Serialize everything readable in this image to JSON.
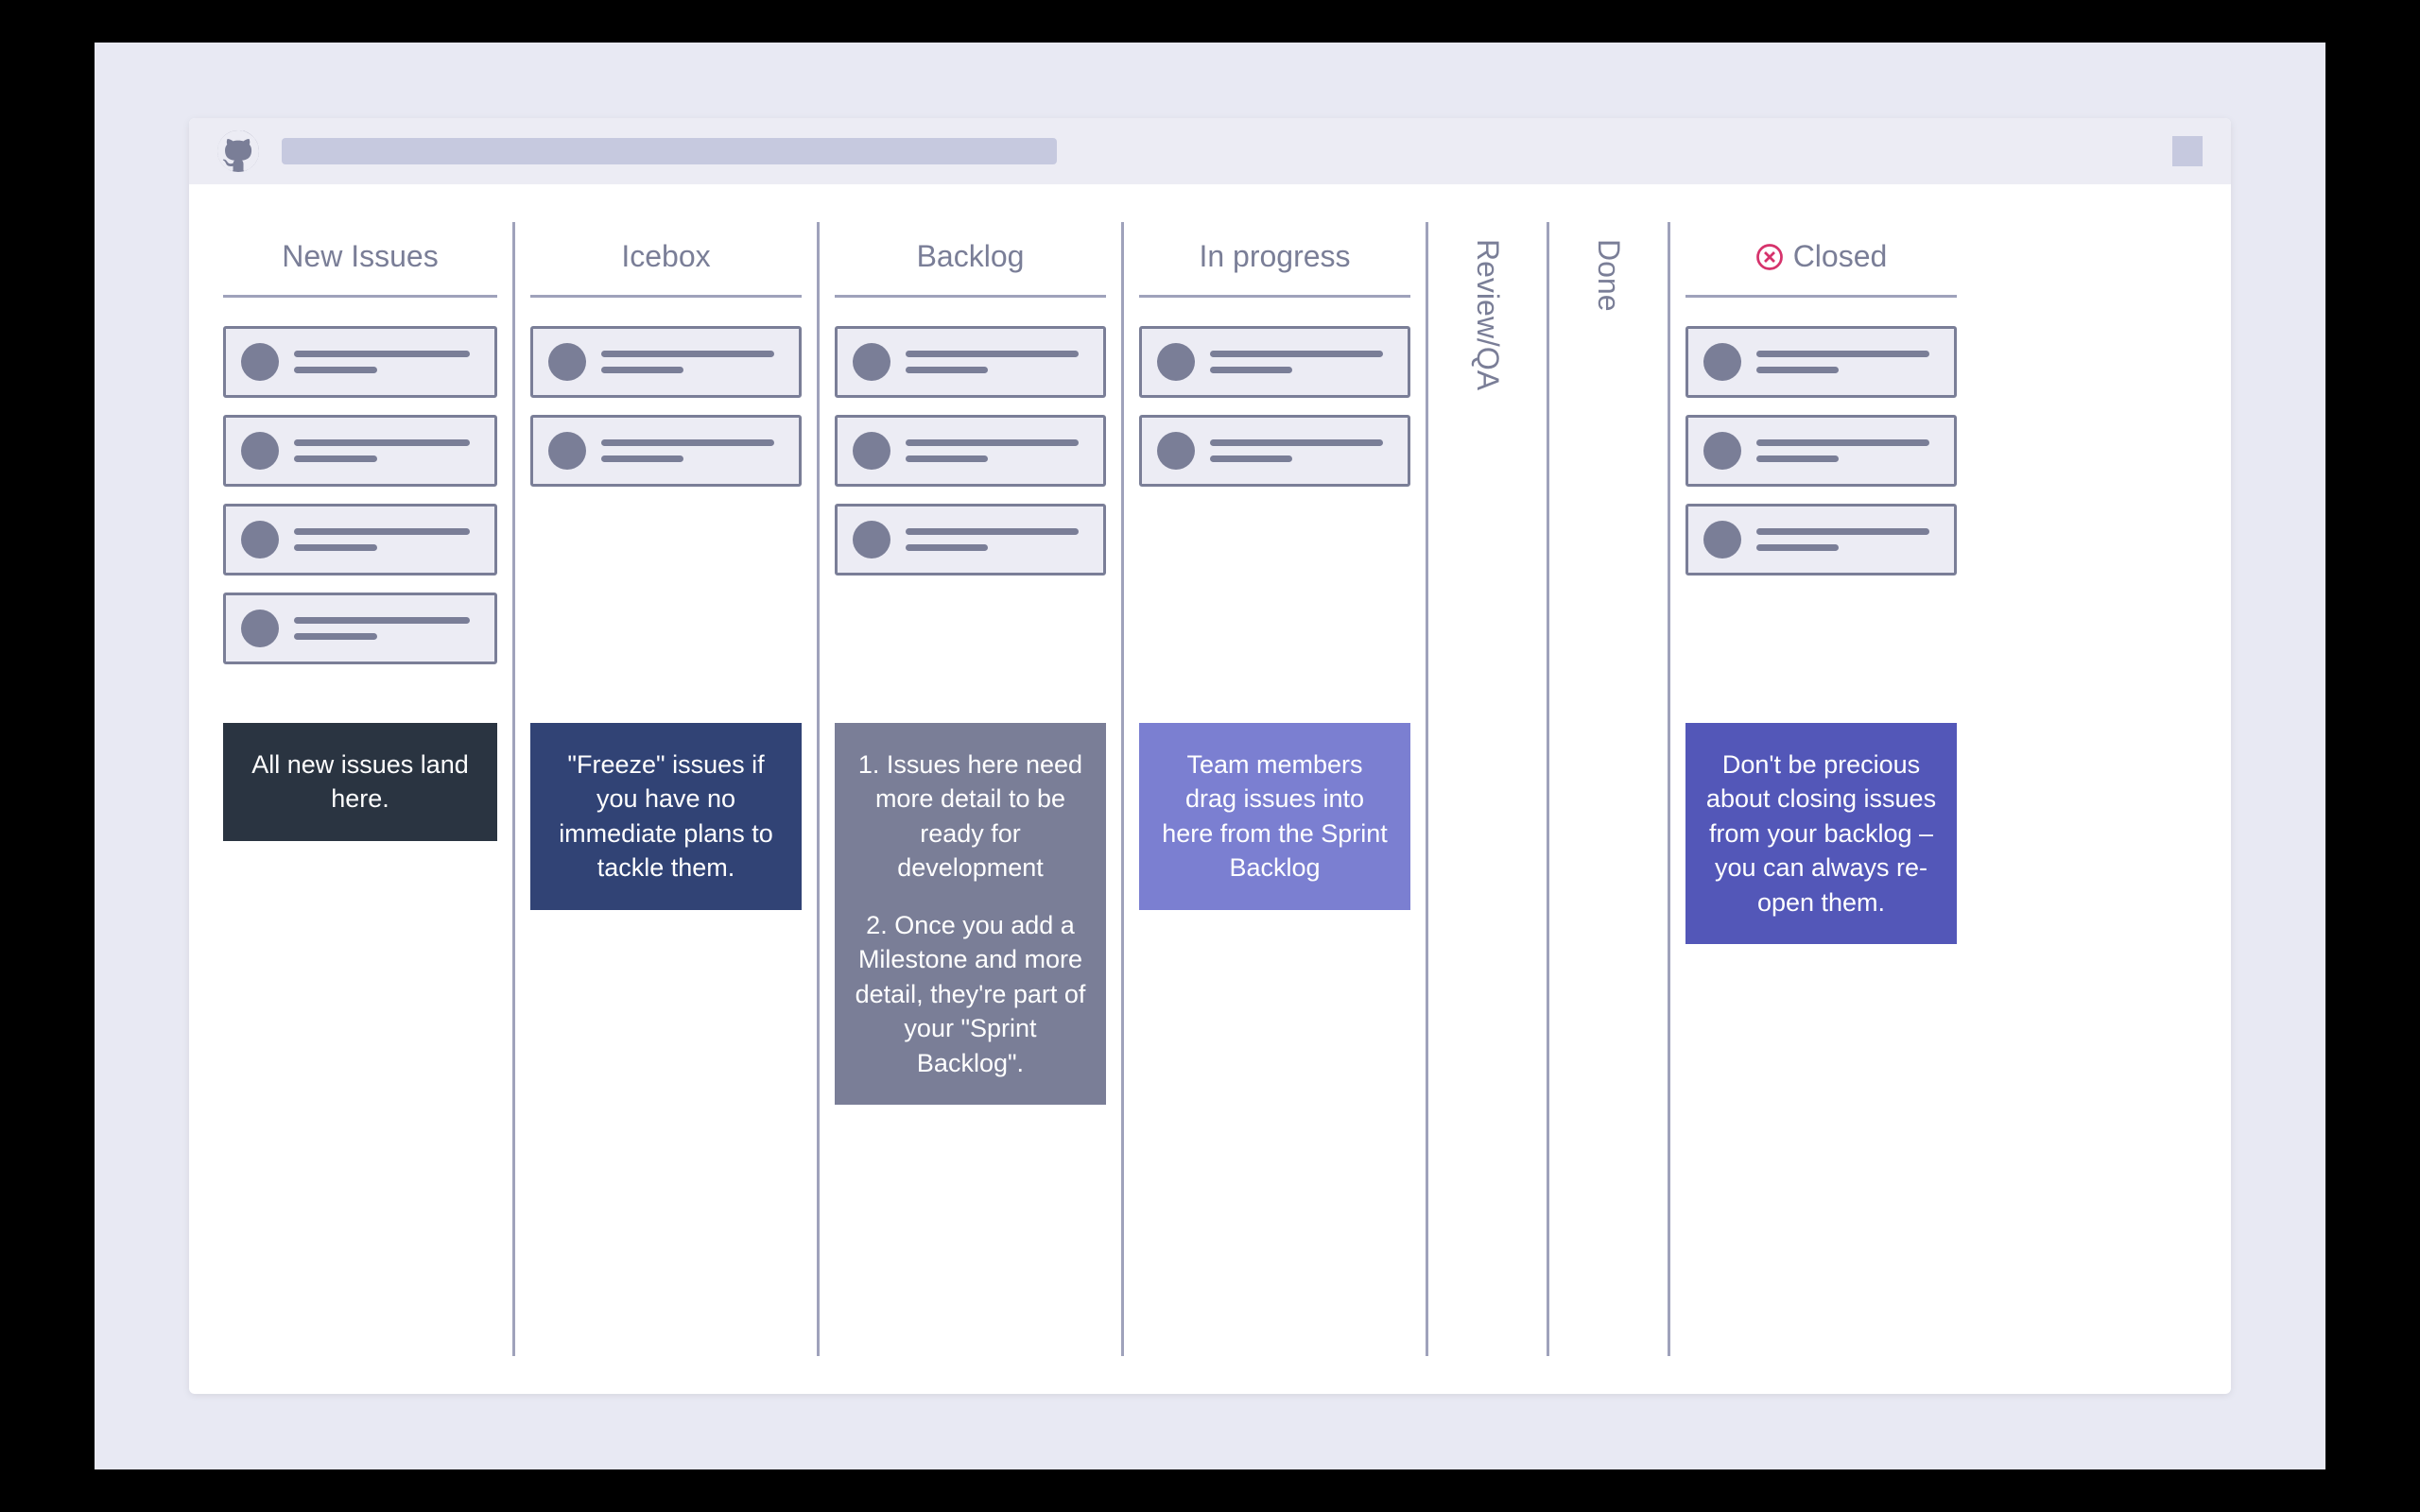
{
  "columns": [
    {
      "id": "new-issues",
      "title": "New Issues",
      "layout": "wide",
      "card_count": 4,
      "note_class": "note-dark",
      "note_paragraphs": [
        "All new issues land here."
      ]
    },
    {
      "id": "icebox",
      "title": "Icebox",
      "layout": "wide",
      "card_count": 2,
      "note_class": "note-navy",
      "note_paragraphs": [
        "\"Freeze\" issues if you have no immediate plans to tackle them."
      ]
    },
    {
      "id": "backlog",
      "title": "Backlog",
      "layout": "wide",
      "card_count": 3,
      "note_class": "note-gray",
      "note_paragraphs": [
        "1. Issues here need more detail to be ready for development",
        "2. Once you add a Milestone and more detail, they're part of your \"Sprint Backlog\"."
      ]
    },
    {
      "id": "in-progress",
      "title": "In progress",
      "layout": "wide",
      "card_count": 2,
      "note_class": "note-periwinkle",
      "note_paragraphs": [
        "Team members drag issues into here from the Sprint Backlog"
      ]
    },
    {
      "id": "review-qa",
      "title": "Review/QA",
      "layout": "narrow",
      "card_count": 0,
      "note_class": null,
      "note_paragraphs": []
    },
    {
      "id": "done",
      "title": "Done",
      "layout": "narrow",
      "card_count": 0,
      "note_class": null,
      "note_paragraphs": []
    },
    {
      "id": "closed",
      "title": "Closed",
      "layout": "wide",
      "has_close_icon": true,
      "card_count": 3,
      "note_class": "note-indigo",
      "note_paragraphs": [
        "Don't be precious about closing issues from your backlog – you can always re-open them."
      ]
    }
  ],
  "colors": {
    "frame_bg": "#e8e9f3",
    "header_bg": "#ececf4",
    "divider": "#9fa2bb",
    "text_muted": "#7a7e97",
    "close_icon": "#d6336c"
  }
}
